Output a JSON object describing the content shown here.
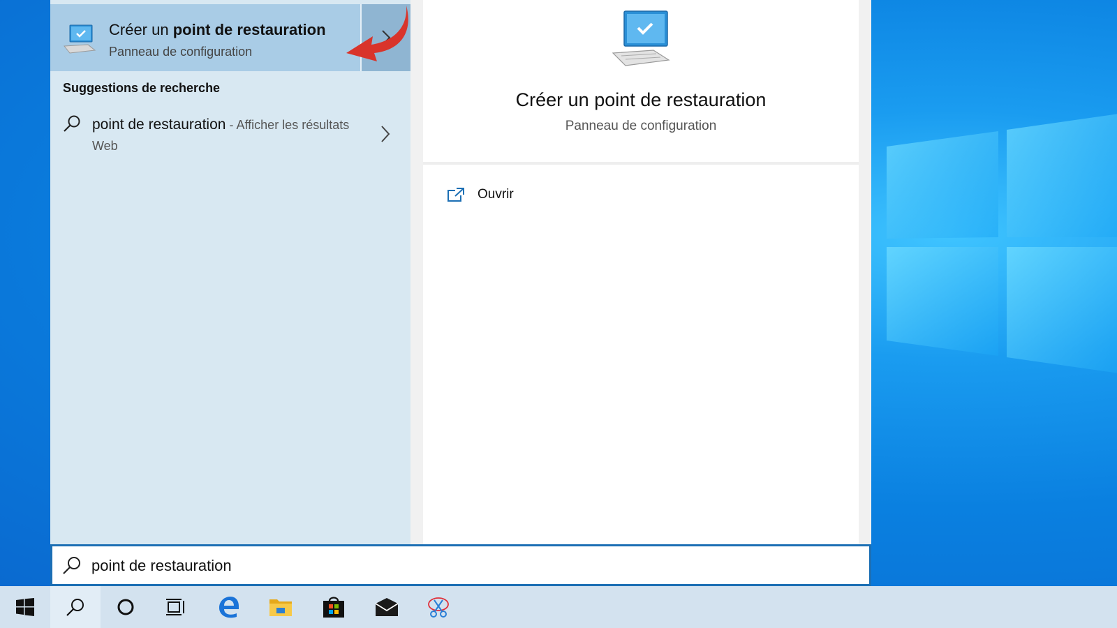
{
  "best_match": {
    "title_prefix": "Créer un",
    "title_bold": "point de restauration",
    "subtitle": "Panneau de configuration"
  },
  "suggestions": {
    "header": "Suggestions de recherche",
    "items": [
      {
        "query": "point de restauration",
        "separator": " - ",
        "detail": "Afficher les résultats Web"
      }
    ]
  },
  "preview": {
    "title": "Créer un point de restauration",
    "subtitle": "Panneau de configuration",
    "actions": [
      {
        "label": "Ouvrir",
        "icon": "open-icon"
      }
    ]
  },
  "search": {
    "value": "point de restauration"
  },
  "taskbar": {
    "items": [
      {
        "icon": "windows-start-icon"
      },
      {
        "icon": "search-icon",
        "active": true
      },
      {
        "icon": "cortana-icon"
      },
      {
        "icon": "task-view-icon"
      },
      {
        "icon": "edge-icon"
      },
      {
        "icon": "file-explorer-icon"
      },
      {
        "icon": "store-icon"
      },
      {
        "icon": "mail-icon"
      },
      {
        "icon": "snipping-tool-icon"
      }
    ]
  },
  "colors": {
    "accent": "#1c6fb4",
    "best_match_bg": "#a9cce6",
    "left_pane_bg": "#d8e8f2",
    "taskbar_bg": "#d3e2ef",
    "arrow_red": "#d9342b"
  }
}
